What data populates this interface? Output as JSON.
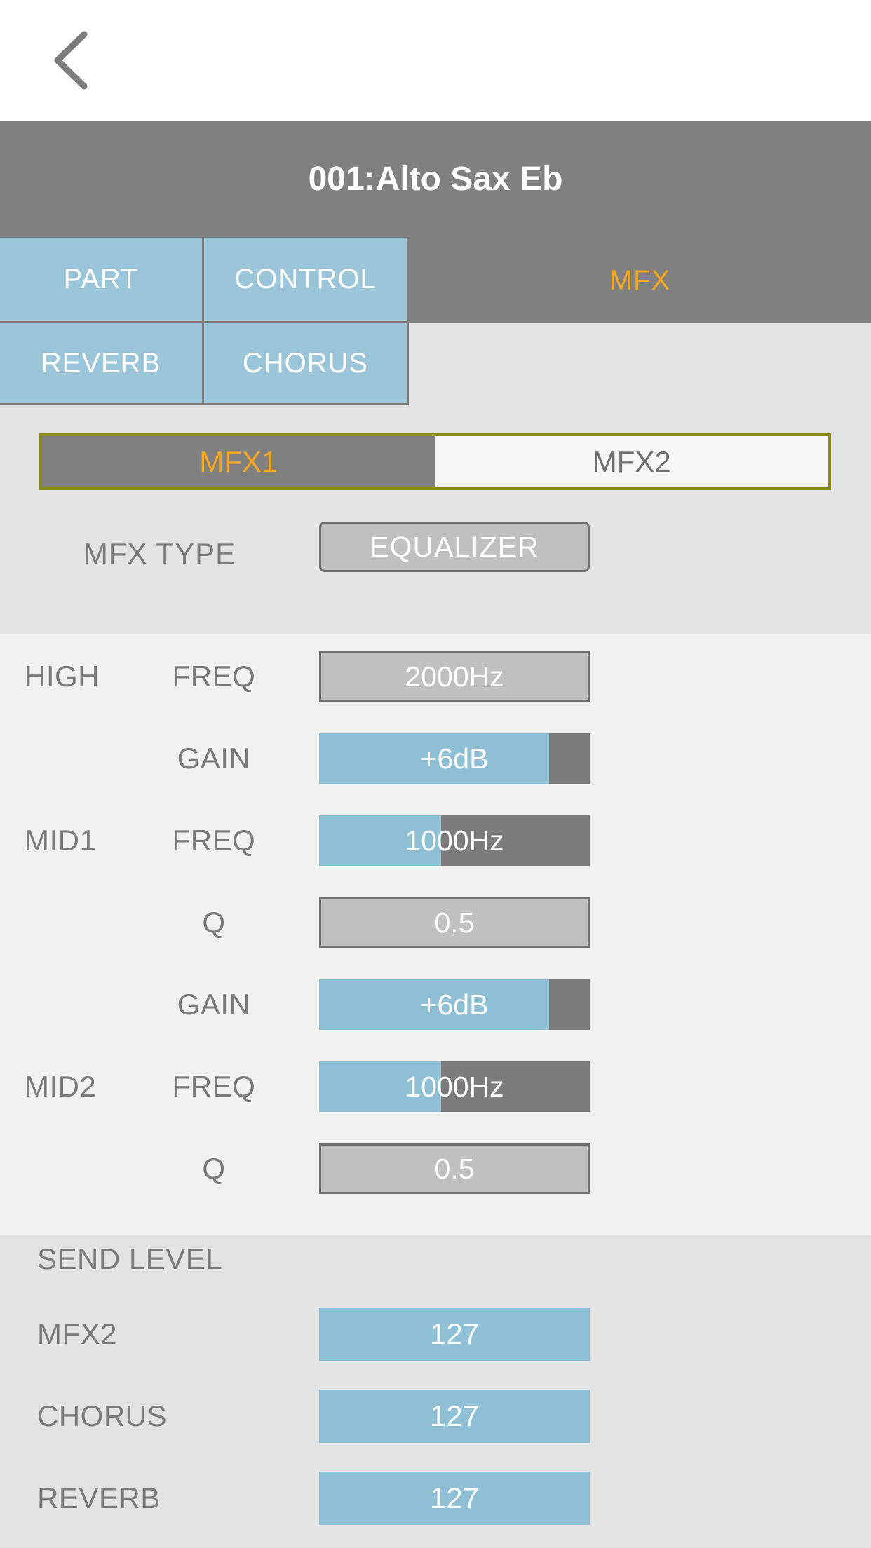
{
  "navbar": {
    "back_label": "Back",
    "back_icon": "chevron-left-icon"
  },
  "header": {
    "title": "001:Alto Sax Eb"
  },
  "tabs": [
    {
      "label": "PART",
      "active": false
    },
    {
      "label": "CONTROL",
      "active": false
    },
    {
      "label": "MFX",
      "active": true
    },
    {
      "label": "REVERB",
      "active": false
    },
    {
      "label": "CHORUS",
      "active": false
    }
  ],
  "mfx": {
    "toggle": [
      {
        "label": "MFX1",
        "selected": true
      },
      {
        "label": "MFX2",
        "selected": false
      }
    ],
    "type_label": "MFX TYPE",
    "type_value": "EQUALIZER"
  },
  "params": [
    {
      "group": "HIGH",
      "name": "FREQ",
      "value": "2000Hz",
      "control": "box",
      "fill_pct": 0
    },
    {
      "group": "",
      "name": "GAIN",
      "value": "+6dB",
      "control": "slider",
      "fill_pct": 85
    },
    {
      "group": "MID1",
      "name": "FREQ",
      "value": "1000Hz",
      "control": "slider",
      "fill_pct": 45
    },
    {
      "group": "",
      "name": "Q",
      "value": "0.5",
      "control": "box",
      "fill_pct": 0
    },
    {
      "group": "",
      "name": "GAIN",
      "value": "+6dB",
      "control": "slider",
      "fill_pct": 85
    },
    {
      "group": "MID2",
      "name": "FREQ",
      "value": "1000Hz",
      "control": "slider",
      "fill_pct": 45
    },
    {
      "group": "",
      "name": "Q",
      "value": "0.5",
      "control": "box",
      "fill_pct": 0
    }
  ],
  "send": {
    "title": "SEND LEVEL",
    "rows": [
      {
        "label": "MFX2",
        "value": "127",
        "fill_pct": 100
      },
      {
        "label": "CHORUS",
        "value": "127",
        "fill_pct": 100
      },
      {
        "label": "REVERB",
        "value": "127",
        "fill_pct": 100
      }
    ]
  },
  "colors": {
    "accent_orange": "#F5A623",
    "tab_blue": "#9BC5D8",
    "slider_fill": "#8FBFD4",
    "slider_track": "#7C7C7C",
    "header_gray": "#808080",
    "toggle_border_olive": "#8A8A1A"
  }
}
